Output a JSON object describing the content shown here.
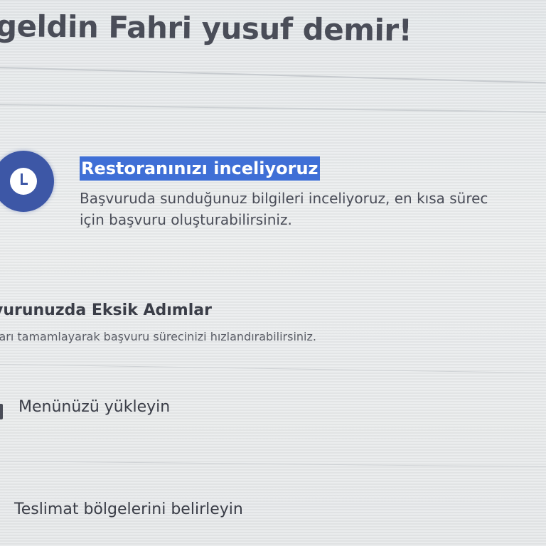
{
  "header": {
    "welcome_text": "geldin Fahri yusuf demir!"
  },
  "status": {
    "icon": "clock-icon",
    "accent_color": "#3d57a6",
    "highlight_color": "#3f6fd6",
    "title": "Restoranınızı inceliyoruz",
    "description_line1": "Başvuruda sunduğunuz bilgileri inceliyoruz, en kısa sürec",
    "description_line2": "için başvuru oluşturabilirsiniz."
  },
  "missing_steps": {
    "title": "vurunuzda Eksik Adımlar",
    "description": "ları tamamlayarak başvuru sürecinizi hızlandırabilirsiniz.",
    "items": [
      {
        "label": "Menünüzü yükleyin"
      },
      {
        "label": "Teslimat bölgelerini belirleyin"
      }
    ]
  }
}
